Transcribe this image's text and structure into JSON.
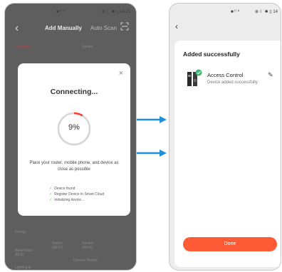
{
  "left": {
    "status_bar": {
      "center": "■ ᵗˡ ᐞ",
      "right": "⊕ ☾ ✱ ▯ 14:21"
    },
    "header": {
      "back": "‹",
      "title": "Add Manually",
      "tab2": "Auto Scan"
    },
    "background": {
      "top_left": "Electrician",
      "top_right": "Socket",
      "bottom_1": "Energy",
      "bottom_2_a": "Switch (Wi-Fi)",
      "bottom_2_b": "Socket (Wi-Fi)",
      "bottom_3": "Automation (BLE)",
      "bottom_4": "Dimmer Switch",
      "bottom_5": "Lighting &"
    },
    "dialog": {
      "close": "×",
      "title": "Connecting...",
      "progress_label": "9%",
      "progress": 0.09,
      "description": "Place your router, mobile phone, and device as close as possible",
      "steps": [
        {
          "check": "✓",
          "text": "Device found"
        },
        {
          "check": "✓",
          "text": "Register Device to Smart Cloud"
        },
        {
          "check": "✓",
          "text": "Initializing device..."
        }
      ]
    }
  },
  "right": {
    "status_bar": {
      "center": "■ ᵗˡ ᐞ",
      "right": "⊕ ☾ ✱ ▯ 14"
    },
    "back": "‹",
    "card": {
      "heading": "Added successfully",
      "device_name": "Access Control",
      "device_sub": "Device added successfully",
      "edit": "✎",
      "done": "Done"
    }
  },
  "colors": {
    "accent": "#ff5a36",
    "arrow": "#1e90d8",
    "check": "#4caf50",
    "progress": "#ff3b30"
  }
}
